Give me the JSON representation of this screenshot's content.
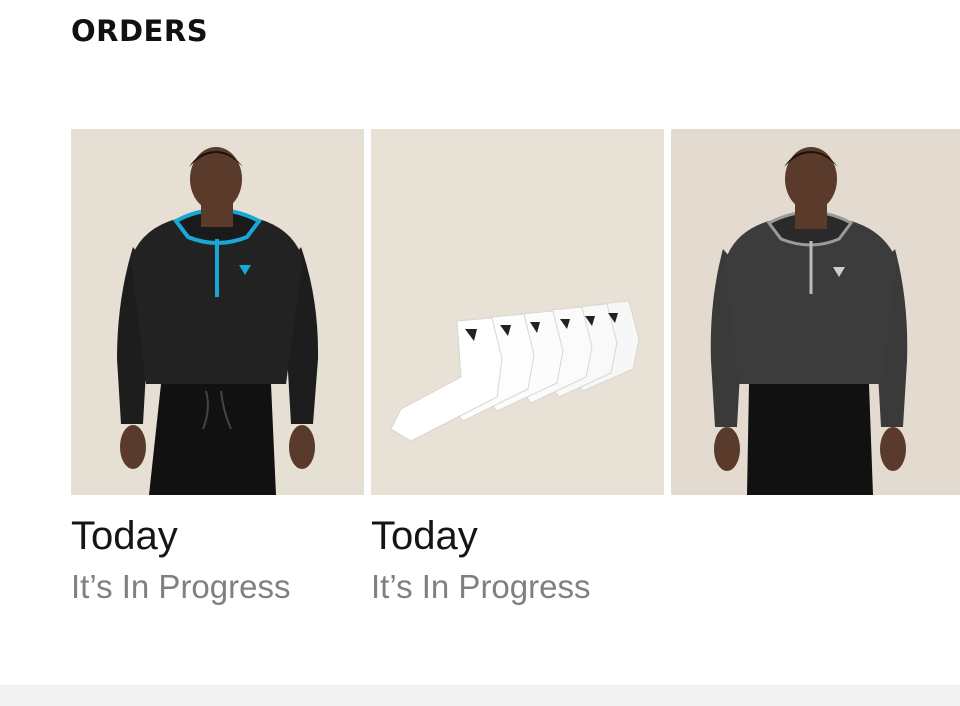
{
  "header": {
    "title": "ORDERS"
  },
  "orders": [
    {
      "date": "Today",
      "status": "It’s In Progress",
      "image_icon": "hoodie-product-image"
    },
    {
      "date": "Today",
      "status": "It’s In Progress",
      "image_icon": "socks-product-image"
    },
    {
      "date": "",
      "status": "",
      "image_icon": "grey-hoodie-product-image"
    }
  ],
  "colors": {
    "text_primary": "#151515",
    "text_secondary": "#808080",
    "image_background": "#e8e0d4",
    "accent_blue": "#19a7d6"
  }
}
